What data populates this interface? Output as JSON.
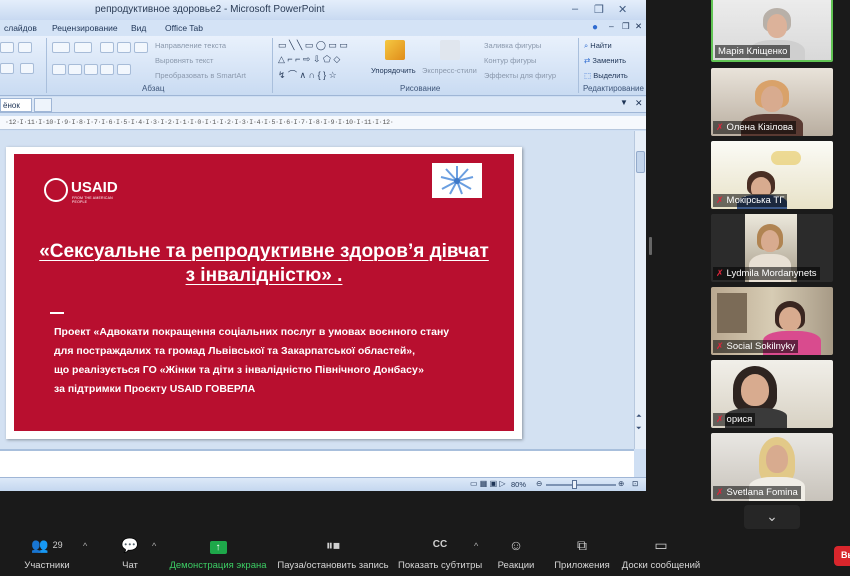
{
  "ppt": {
    "window_title": "репродуктивное здоровье2 - Microsoft PowerPoint",
    "ribbon_tabs": [
      "слайдов",
      "Рецензирование",
      "Вид",
      "Office Tab"
    ],
    "paragraph": {
      "items": [
        "Направление текста",
        "Выровнять текст",
        "Преобразовать в SmartArt"
      ],
      "group_label": "Абзац"
    },
    "drawing": {
      "arrange": "Упорядочить",
      "quick_styles": "Экспресс-стили",
      "fill": "Заливка фигуры",
      "outline": "Контур фигуры",
      "effects": "Эффекты для фигур",
      "group_label": "Рисование"
    },
    "editing": {
      "find": "Найти",
      "replace": "Заменить",
      "select": "Выделить",
      "group_label": "Редактирование"
    },
    "doc_tab": "ёнок",
    "ruler_text": "·12·I·11·I·10·I·9·I·8·I·7·I·6·I·5·I·4·I·3·I·2·I·1·I·0·I·1·I·2·I·3·I·4·I·5·I·6·I·7·I·8·I·9·I·10·I·11·I·12·",
    "zoom": "80%"
  },
  "slide": {
    "logo_text": "USAID",
    "logo_subtext": "FROM THE AMERICAN PEOPLE",
    "title": "«Сексуальне та репродуктивне здоров’я дівчат з інвалідністю» .",
    "body_lines": [
      "Проект «Адвокати покращення соціальних послуг в умовах воєнного стану",
      "для постраждалих та громад Львівської та Закарпатської областей»,",
      "що реалізується ГО «Жінки та діти з інвалідністю Північного Донбасу»",
      "за підтримки Проєкту USAID ГОВЕРЛА"
    ]
  },
  "participants": [
    {
      "name": "Марія Кліщенко",
      "muted": false
    },
    {
      "name": "Олена Кізілова",
      "muted": true
    },
    {
      "name": "Мокірська ТГ",
      "muted": true
    },
    {
      "name": "Lydmila Mordanynets",
      "muted": true
    },
    {
      "name": "Social Sokilnyky",
      "muted": true
    },
    {
      "name": "орися",
      "muted": true
    },
    {
      "name": "Svetlana Fomina",
      "muted": true
    }
  ],
  "toolbar": {
    "participants_count": "29",
    "participants_label": "Участники",
    "chat_label": "Чат",
    "share_label": "Демонстрация экрана",
    "record_label": "Пауза/остановить запись",
    "captions_label": "Показать субтитры",
    "reactions_label": "Реакции",
    "apps_label": "Приложения",
    "whiteboard_label": "Доски сообщений",
    "end_label": "Вы"
  },
  "colors": {
    "slide_red": "#b80f2f",
    "share_green": "#1ea84a",
    "active_speaker": "#61c454"
  }
}
